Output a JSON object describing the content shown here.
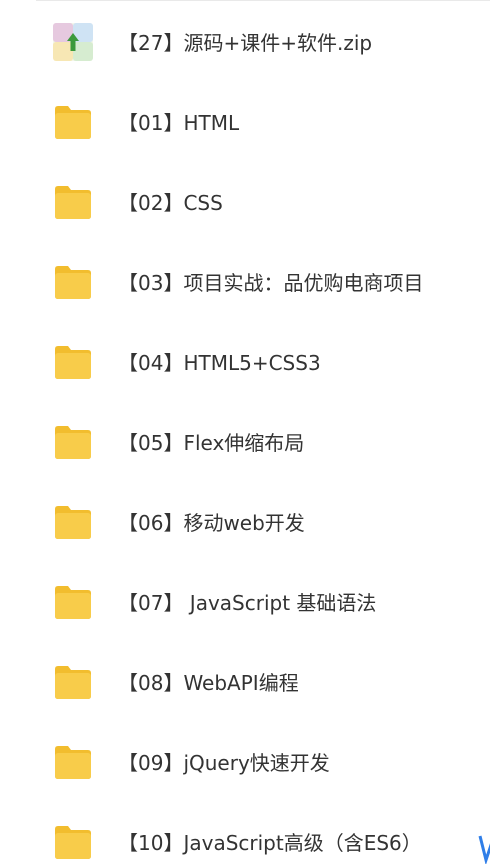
{
  "files": [
    {
      "name": "【27】源码+课件+软件.zip",
      "icon": "zip-archive-icon"
    },
    {
      "name": "【01】HTML",
      "icon": "folder-icon"
    },
    {
      "name": "【02】CSS",
      "icon": "folder-icon"
    },
    {
      "name": "【03】项目实战：品优购电商项目",
      "icon": "folder-icon"
    },
    {
      "name": "【04】HTML5+CSS3",
      "icon": "folder-icon"
    },
    {
      "name": "【05】Flex伸缩布局",
      "icon": "folder-icon"
    },
    {
      "name": "【06】移动web开发",
      "icon": "folder-icon"
    },
    {
      "name": "【07】 JavaScript 基础语法",
      "icon": "folder-icon"
    },
    {
      "name": "【08】WebAPI编程",
      "icon": "folder-icon"
    },
    {
      "name": "【09】jQuery快速开发",
      "icon": "folder-icon"
    },
    {
      "name": "【10】JavaScript高级（含ES6）",
      "icon": "folder-icon"
    }
  ],
  "colors": {
    "folder": "#f8cc4a",
    "folder_tab": "#f2bd2e",
    "text": "#333333",
    "accent_blue": "#2f7ee8"
  }
}
